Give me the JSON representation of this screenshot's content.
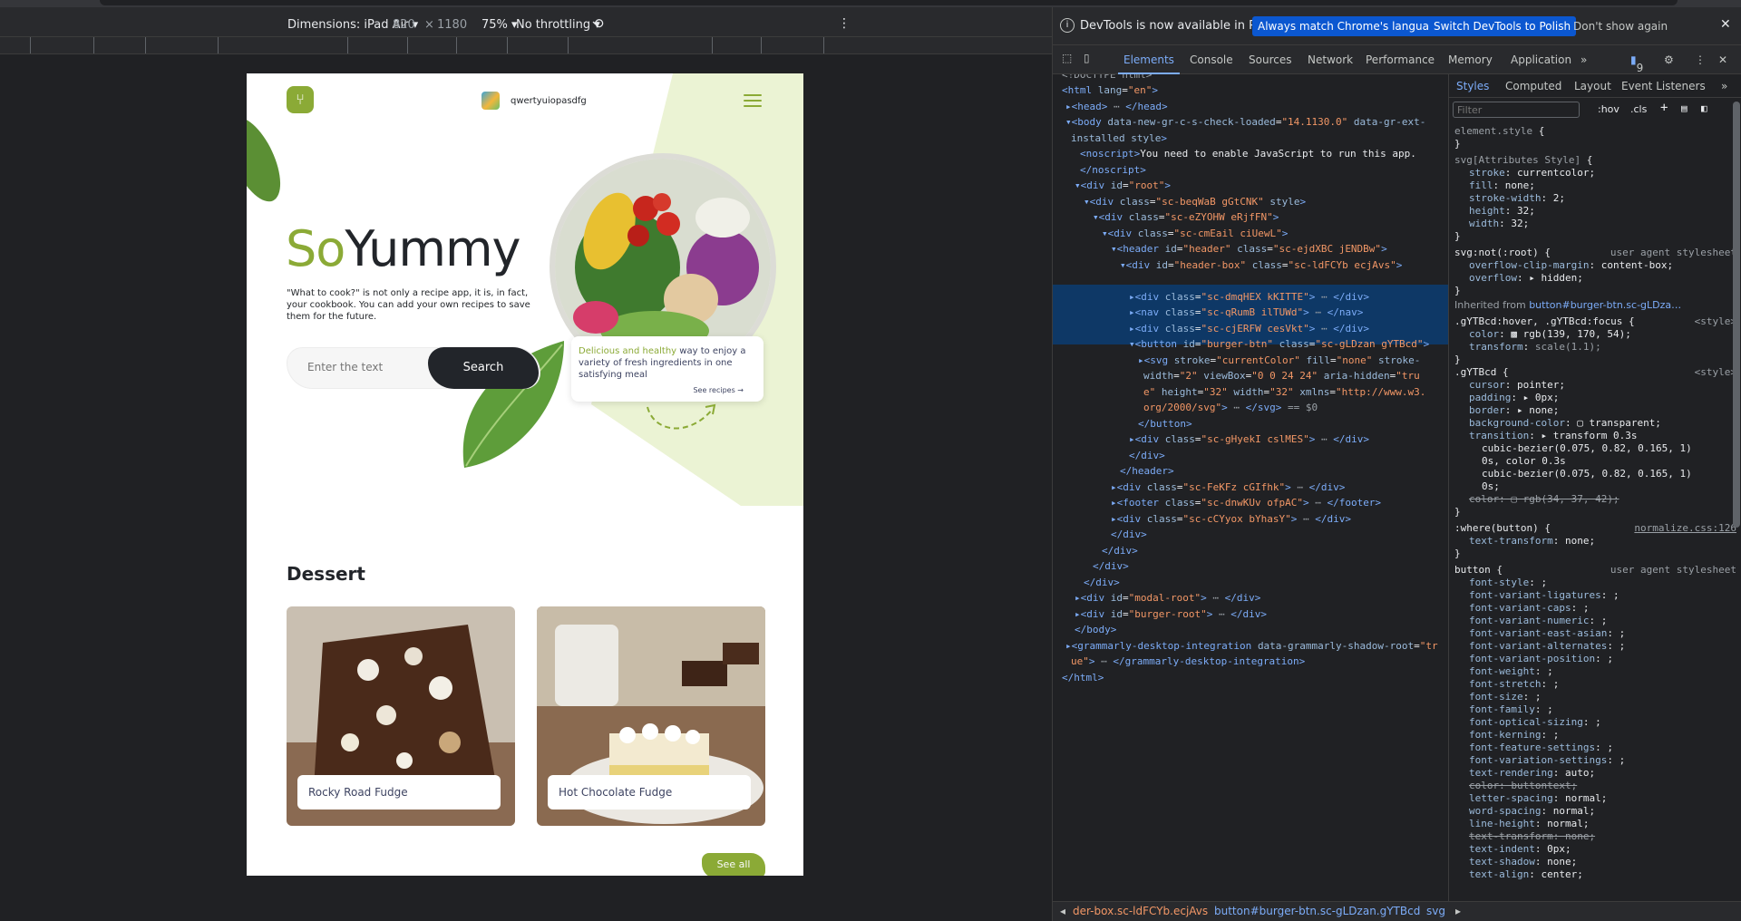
{
  "device_toolbar": {
    "dimensions_label": "Dimensions: iPad Air",
    "width": "820",
    "times": "×",
    "height": "1180",
    "zoom": "75%",
    "throttling": "No throttling"
  },
  "app": {
    "username": "qwertyuiopasdfg",
    "title_so": "So",
    "title_yummy": "Yummy",
    "subtitle": "\"What to cook?\" is not only a recipe app, it is, in fact, your cookbook. You can add your own recipes to save them for the future.",
    "search_placeholder": "Enter the text",
    "search_button": "Search",
    "promo_green": "Delicious and healthy",
    "promo_rest": " way to enjoy a variety of fresh ingredients in one satisfying meal",
    "promo_link": "See recipes →",
    "section_title": "Dessert",
    "recipes": [
      {
        "name": "Rocky Road Fudge"
      },
      {
        "name": "Hot Chocolate Fudge"
      }
    ],
    "see_all": "See all",
    "brand_color": "#8baa36"
  },
  "devtools": {
    "infobar_text": "DevTools is now available in Polish!",
    "btn_match": "Always match Chrome's language",
    "btn_switch": "Switch DevTools to Polish",
    "btn_dismiss": "Don't show again",
    "tabs": [
      "Elements",
      "Console",
      "Sources",
      "Network",
      "Performance",
      "Memory",
      "Application"
    ],
    "issues_count": "9",
    "styles_tabs": [
      "Styles",
      "Computed",
      "Layout",
      "Event Listeners"
    ],
    "filter_placeholder": "Filter",
    "hov": ":hov",
    "cls": ".cls",
    "breadcrumbs": [
      "der-box.sc-ldFCYb.ecjAvs",
      "button#burger-btn.sc-gLDzan.gYTBcd",
      "svg"
    ]
  }
}
